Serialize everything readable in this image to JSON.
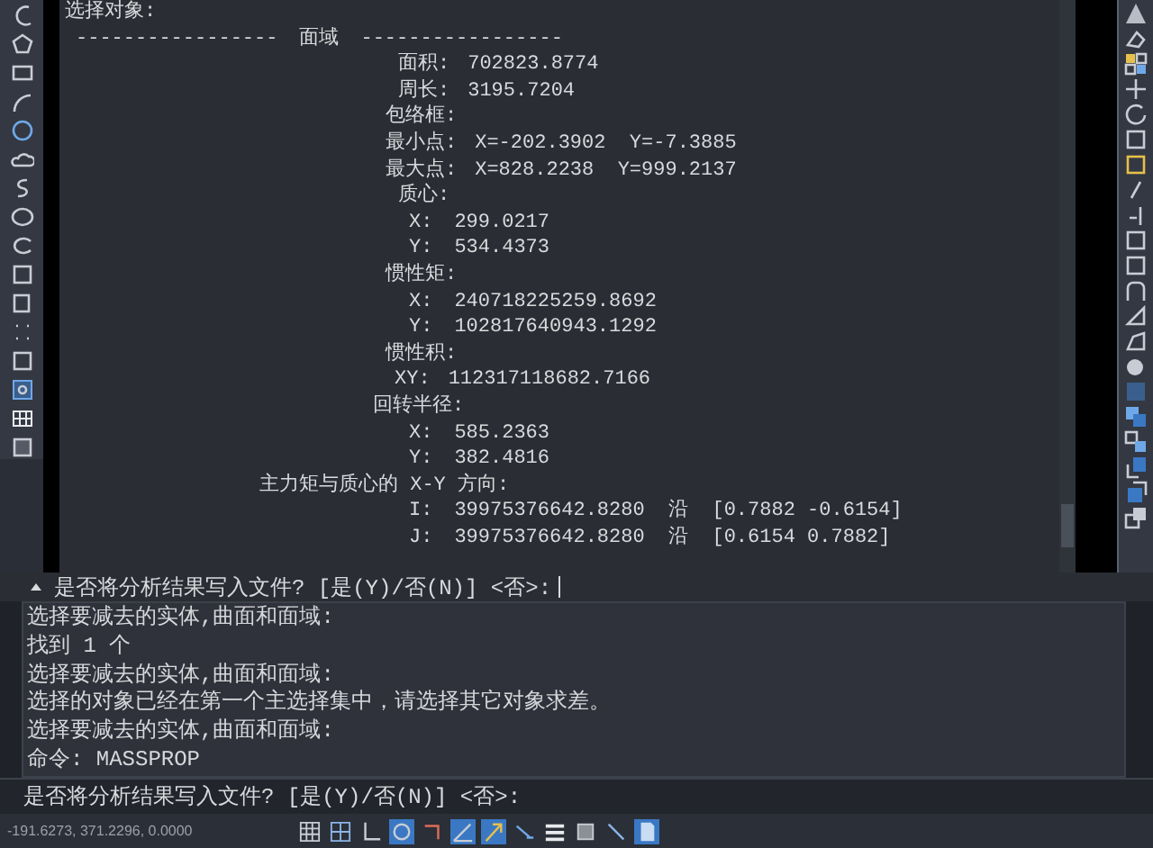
{
  "output": {
    "lines": [
      {
        "kind": "prompt",
        "label": "选择对象:"
      },
      {
        "kind": "separator",
        "left": "-----------------",
        "title": "面域",
        "right": "-----------------"
      },
      {
        "kind": "item",
        "label": "面积:",
        "value": "702823.8774"
      },
      {
        "kind": "item",
        "label": "周长:",
        "value": "3195.7204"
      },
      {
        "kind": "group",
        "label": "包络框:"
      },
      {
        "kind": "group",
        "label": "最小点:",
        "value": "X=-202.3902  Y=-7.3885"
      },
      {
        "kind": "group",
        "label": "最大点:",
        "value": "X=828.2238  Y=999.2137"
      },
      {
        "kind": "item",
        "label": "质心:"
      },
      {
        "kind": "sub",
        "label": "X:",
        "value": "299.0217"
      },
      {
        "kind": "sub",
        "label": "Y:",
        "value": "534.4373"
      },
      {
        "kind": "group",
        "label": "惯性矩:"
      },
      {
        "kind": "sub",
        "label": "X:",
        "value": "240718225259.8692"
      },
      {
        "kind": "sub",
        "label": "Y:",
        "value": "102817640943.1292"
      },
      {
        "kind": "group",
        "label": "惯性积:"
      },
      {
        "kind": "pair",
        "label": "XY:",
        "value": "112317118682.7166"
      },
      {
        "kind": "radius",
        "label": "回转半径:"
      },
      {
        "kind": "sub",
        "label": "X:",
        "value": "585.2363"
      },
      {
        "kind": "sub",
        "label": "Y:",
        "value": "382.4816"
      },
      {
        "kind": "principal",
        "label": "主力矩与质心的 X-Y 方向:"
      },
      {
        "kind": "sub",
        "label": "I:",
        "value": "39975376642.8280  沿  [0.7882 -0.6154]"
      },
      {
        "kind": "sub",
        "label": "J:",
        "value": "39975376642.8280  沿  [0.6154 0.7882]"
      }
    ]
  },
  "prompt": {
    "text": "是否将分析结果写入文件? [是(Y)/否(N)] <否>:"
  },
  "history": [
    "选择要减去的实体,曲面和面域:",
    "找到 1 个",
    "选择要减去的实体,曲面和面域:",
    "选择的对象已经在第一个主选择集中，请选择其它对象求差。",
    "选择要减去的实体,曲面和面域:",
    "命令: MASSPROP"
  ],
  "command_line": {
    "value": "是否将分析结果写入文件? [是(Y)/否(N)] <否>:"
  },
  "status_bar": {
    "coordinates": "-191.6273, 371.2296, 0.0000",
    "toggles": [
      {
        "kind": "grid",
        "on": false
      },
      {
        "kind": "snap",
        "on": false
      },
      {
        "kind": "ortho",
        "on": false
      },
      {
        "kind": "polar",
        "on": true
      },
      {
        "kind": "osnap",
        "on": false
      },
      {
        "kind": "otrack",
        "on": true
      },
      {
        "kind": "dynucs",
        "on": true
      },
      {
        "kind": "dyn",
        "on": false
      },
      {
        "kind": "lineweight",
        "on": false
      },
      {
        "kind": "transparency",
        "on": false
      },
      {
        "kind": "selection",
        "on": false
      },
      {
        "kind": "annotate",
        "on": true
      }
    ]
  }
}
